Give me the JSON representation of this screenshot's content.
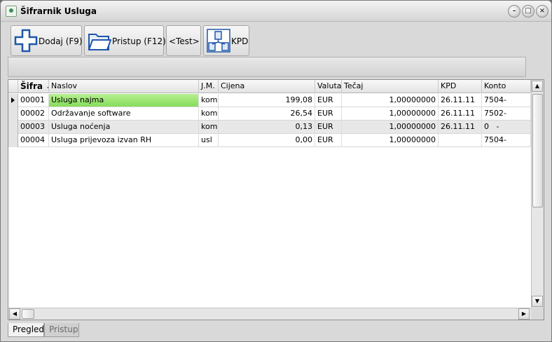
{
  "window": {
    "title": "Šifrarnik Usluga",
    "minimize_glyph": "–",
    "restore_glyph": "□",
    "close_glyph": "×"
  },
  "toolbar": {
    "add_label": "Dodaj (F9)",
    "open_label": "Pristup (F12)",
    "test_label": "<Test>",
    "kpd_label": "KPD"
  },
  "grid": {
    "columns": [
      "Šifra ↓",
      "Naslov",
      "J.M.",
      "Cijena",
      "Valuta",
      "Tečaj",
      "KPD",
      "Konto"
    ],
    "rows": [
      {
        "sifra": "00001",
        "naslov": "Usluga najma",
        "jm": "kom",
        "cijena": "199,08",
        "valuta": "EUR",
        "tecaj": "1,00000000",
        "kpd": "26.11.11",
        "konto": "7504-"
      },
      {
        "sifra": "00002",
        "naslov": "Održavanje software",
        "jm": "kom",
        "cijena": "26,54",
        "valuta": "EUR",
        "tecaj": "1,00000000",
        "kpd": "26.11.11",
        "konto": "7502-"
      },
      {
        "sifra": "00003",
        "naslov": "Usluga noćenja",
        "jm": "kom",
        "cijena": "0,13",
        "valuta": "EUR",
        "tecaj": "1,00000000",
        "kpd": "26.11.11",
        "konto": "0   -"
      },
      {
        "sifra": "00004",
        "naslov": "Usluga prijevoza izvan RH",
        "jm": "usl",
        "cijena": "0,00",
        "valuta": "EUR",
        "tecaj": "1,00000000",
        "kpd": "",
        "konto": "7504-"
      }
    ],
    "selected_row": 0
  },
  "tabs": [
    {
      "label": "Pregled",
      "active": true
    },
    {
      "label": "Pristup",
      "active": false
    }
  ],
  "colors": {
    "selection": "#93e366",
    "accent": "#1f57a8"
  }
}
